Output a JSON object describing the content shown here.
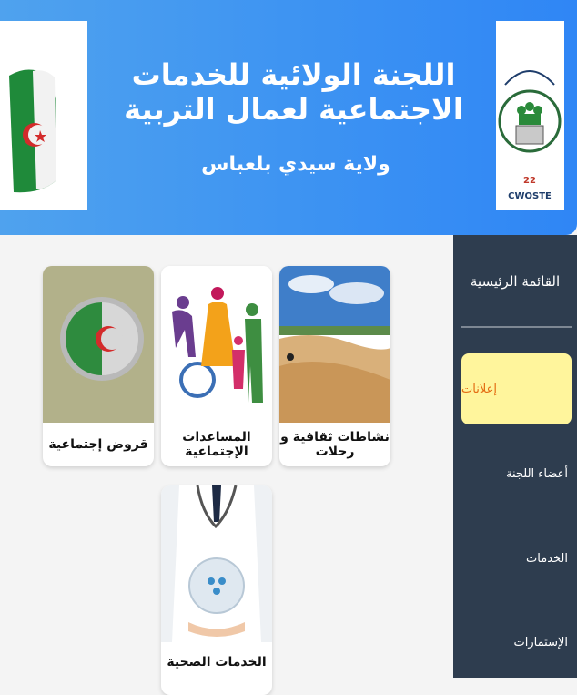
{
  "header": {
    "title": "اللجنة الولائية للخدمات الاجتماعية لعمال التربية",
    "subtitle": "ولاية سيدي بلعباس",
    "logo_number": "22",
    "logo_text": "CWOSTE"
  },
  "sidebar": {
    "title": "القائمة الرئيسية",
    "items": [
      {
        "label": "إعلانات",
        "active": true
      },
      {
        "label": "أعضاء اللجنة",
        "active": false
      },
      {
        "label": "الخدمات",
        "active": false
      },
      {
        "label": "الإستمارات",
        "active": false
      }
    ]
  },
  "cards": [
    {
      "label": "نشاطات ثقافية و رحلات",
      "image": "desert-landscape"
    },
    {
      "label": "المساعدات الإجتماعية",
      "image": "family-silhouettes"
    },
    {
      "label": "قروض إجتماعية",
      "image": "algerian-coin-money"
    },
    {
      "label": "الخدمات الصحية",
      "image": "doctor-health"
    }
  ],
  "colors": {
    "header_gradient": [
      "#4fa2ee",
      "#2f86f5"
    ],
    "sidebar_bg": "#2e3d4f",
    "active_bg": "#fff59c",
    "active_text": "#e36b12"
  }
}
